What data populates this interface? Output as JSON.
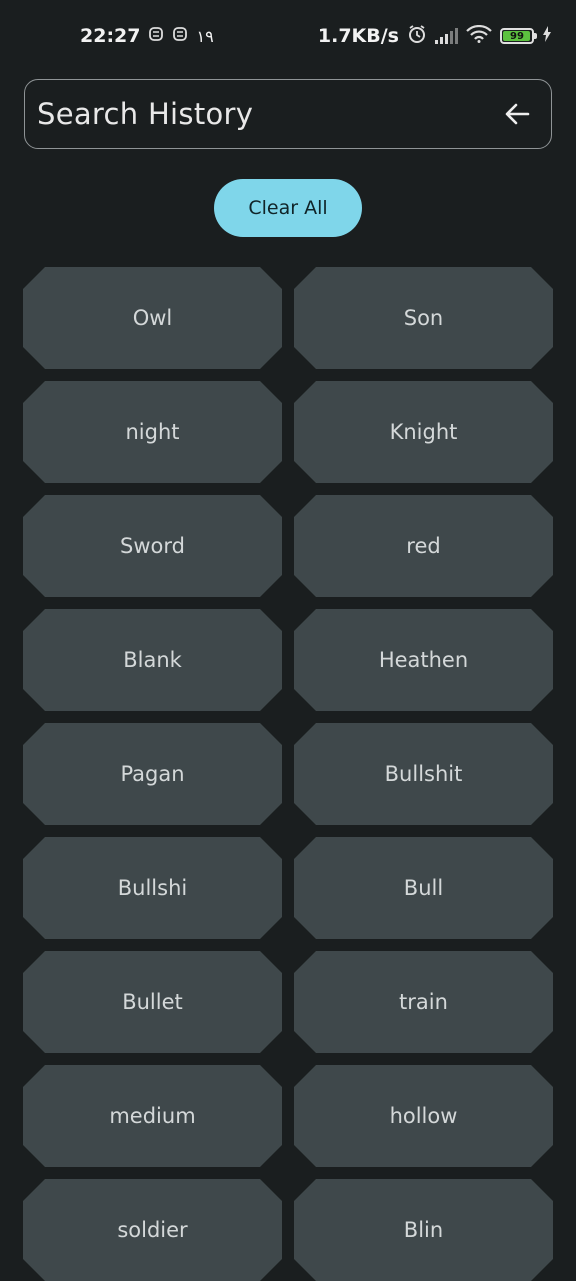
{
  "status_bar": {
    "time": "22:27",
    "extra": "۱۹",
    "speed": "1.7KB/s",
    "battery": "99"
  },
  "search": {
    "title": "Search History",
    "back_icon": "arrow-left-icon"
  },
  "clear_button": {
    "label": "Clear All"
  },
  "history": [
    {
      "label": "Owl"
    },
    {
      "label": "Son"
    },
    {
      "label": "night"
    },
    {
      "label": "Knight"
    },
    {
      "label": "Sword"
    },
    {
      "label": "red"
    },
    {
      "label": "Blank"
    },
    {
      "label": "Heathen"
    },
    {
      "label": "Pagan"
    },
    {
      "label": "Bullshit"
    },
    {
      "label": "Bullshi"
    },
    {
      "label": "Bull"
    },
    {
      "label": "Bullet"
    },
    {
      "label": "train"
    },
    {
      "label": "medium"
    },
    {
      "label": "hollow"
    },
    {
      "label": "soldier"
    },
    {
      "label": "Blin"
    }
  ],
  "colors": {
    "background": "#1a1e1f",
    "chip": "#3f484b",
    "accent": "#7fd6ea"
  }
}
